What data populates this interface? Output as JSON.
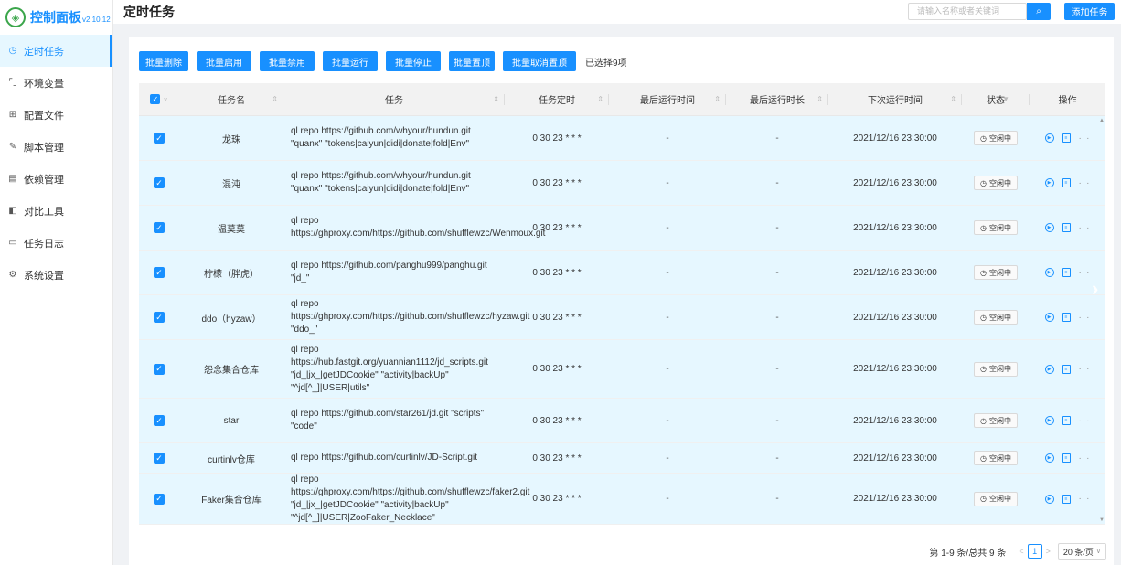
{
  "app": {
    "logo_text": "控制面板",
    "version": "v2.10.12"
  },
  "sidebar": {
    "items": [
      {
        "label": "定时任务",
        "icon": "clock-icon",
        "glyph": "◷",
        "active": true
      },
      {
        "label": "环境变量",
        "icon": "bracket-icon",
        "glyph": "⌜⌟",
        "active": false
      },
      {
        "label": "配置文件",
        "icon": "grid-file-icon",
        "glyph": "⊞",
        "active": false
      },
      {
        "label": "脚本管理",
        "icon": "edit-icon",
        "glyph": "✎",
        "active": false
      },
      {
        "label": "依赖管理",
        "icon": "book-icon",
        "glyph": "▤",
        "active": false
      },
      {
        "label": "对比工具",
        "icon": "diff-icon",
        "glyph": "◧",
        "active": false
      },
      {
        "label": "任务日志",
        "icon": "folder-icon",
        "glyph": "▭",
        "active": false
      },
      {
        "label": "系统设置",
        "icon": "gear-icon",
        "glyph": "⚙",
        "active": false
      }
    ]
  },
  "header": {
    "title": "定时任务",
    "search_placeholder": "请输入名称或者关键词",
    "add_button": "添加任务"
  },
  "toolbar": {
    "buttons": [
      "批量删除",
      "批量启用",
      "批量禁用",
      "批量运行",
      "批量停止",
      "批量置顶",
      "批量取消置顶"
    ],
    "selected_text": "已选择9项"
  },
  "table": {
    "columns": [
      "任务名",
      "任务",
      "任务定时",
      "最后运行时间",
      "最后运行时长",
      "下次运行时间",
      "状态",
      "操作"
    ],
    "rows": [
      {
        "name": "龙珠",
        "task": "ql repo https://github.com/whyour/hundun.git \"quanx\" \"tokens|caiyun|didi|donate|fold|Env\"",
        "schedule": "0 30 23 * * *",
        "last_run": "-",
        "last_duration": "-",
        "next_run": "2021/12/16 23:30:00",
        "status": "空闲中"
      },
      {
        "name": "混沌",
        "task": "ql repo https://github.com/whyour/hundun.git \"quanx\" \"tokens|caiyun|didi|donate|fold|Env\"",
        "schedule": "0 30 23 * * *",
        "last_run": "-",
        "last_duration": "-",
        "next_run": "2021/12/16 23:30:00",
        "status": "空闲中"
      },
      {
        "name": "温莫莫",
        "task": "ql repo https://ghproxy.com/https://github.com/shufflewzc/Wenmoux.git",
        "schedule": "0 30 23 * * *",
        "last_run": "-",
        "last_duration": "-",
        "next_run": "2021/12/16 23:30:00",
        "status": "空闲中"
      },
      {
        "name": "柠檬（胖虎）",
        "task": "ql repo https://github.com/panghu999/panghu.git \"jd_\"",
        "schedule": "0 30 23 * * *",
        "last_run": "-",
        "last_duration": "-",
        "next_run": "2021/12/16 23:30:00",
        "status": "空闲中"
      },
      {
        "name": "ddo（hyzaw）",
        "task": "ql repo https://ghproxy.com/https://github.com/shufflewzc/hyzaw.git \"ddo_\"",
        "schedule": "0 30 23 * * *",
        "last_run": "-",
        "last_duration": "-",
        "next_run": "2021/12/16 23:30:00",
        "status": "空闲中"
      },
      {
        "name": "怨念集合仓库",
        "task": "ql repo https://hub.fastgit.org/yuannian1112/jd_scripts.git \"jd_|jx_|getJDCookie\" \"activity|backUp\" \"^jd[^_]|USER|utils\"",
        "schedule": "0 30 23 * * *",
        "last_run": "-",
        "last_duration": "-",
        "next_run": "2021/12/16 23:30:00",
        "status": "空闲中"
      },
      {
        "name": "star",
        "task": "ql repo https://github.com/star261/jd.git \"scripts\" \"code\"",
        "schedule": "0 30 23 * * *",
        "last_run": "-",
        "last_duration": "-",
        "next_run": "2021/12/16 23:30:00",
        "status": "空闲中"
      },
      {
        "name": "curtinlv仓库",
        "task": "ql repo https://github.com/curtinlv/JD-Script.git",
        "schedule": "0 30 23 * * *",
        "last_run": "-",
        "last_duration": "-",
        "next_run": "2021/12/16 23:30:00",
        "status": "空闲中"
      },
      {
        "name": "Faker集合仓库",
        "task": "ql repo https://ghproxy.com/https://github.com/shufflewzc/faker2.git \"jd_|jx_|getJDCookie\" \"activity|backUp\" \"^jd[^_]|USER|ZooFaker_Necklace\"",
        "schedule": "0 30 23 * * *",
        "last_run": "-",
        "last_duration": "-",
        "next_run": "2021/12/16 23:30:00",
        "status": "空闲中"
      }
    ]
  },
  "pagination": {
    "total_text": "第 1-9 条/总共 9 条",
    "current_page": "1",
    "page_size": "20 条/页"
  },
  "colors": {
    "primary": "#1890ff",
    "selected_row": "#e6f7ff",
    "logo_green": "#3aa54a"
  }
}
